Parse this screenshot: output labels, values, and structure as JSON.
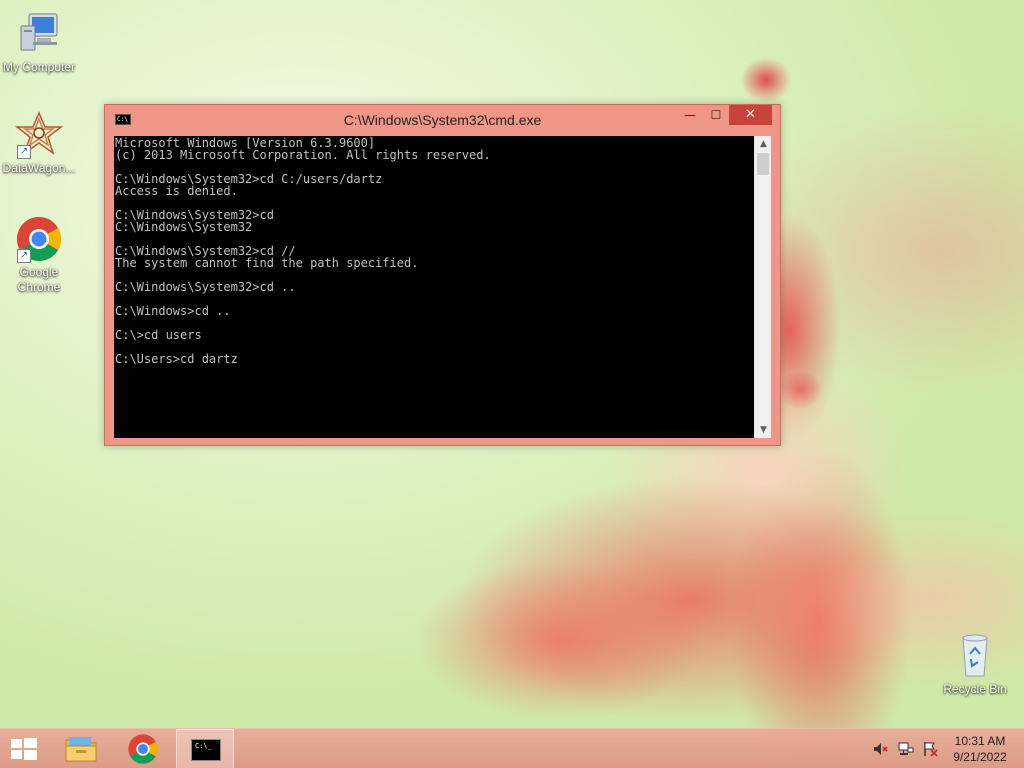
{
  "desktop": {
    "icons": [
      {
        "label": "My Computer",
        "icon": "computer-icon"
      },
      {
        "label": "DataWagon...",
        "icon": "datawagon-icon"
      },
      {
        "label_line1": "Google",
        "label_line2": "Chrome",
        "icon": "chrome-icon"
      },
      {
        "label": "Recycle Bin",
        "icon": "recycle-bin-icon"
      }
    ]
  },
  "window": {
    "title": "C:\\Windows\\System32\\cmd.exe",
    "icon_text": "C:\\",
    "buttons": {
      "minimize": "—",
      "maximize": "☐",
      "close": "✕"
    },
    "console_lines": [
      "Microsoft Windows [Version 6.3.9600]",
      "(c) 2013 Microsoft Corporation. All rights reserved.",
      "",
      "C:\\Windows\\System32>cd C:/users/dartz",
      "Access is denied.",
      "",
      "C:\\Windows\\System32>cd",
      "C:\\Windows\\System32",
      "",
      "C:\\Windows\\System32>cd //",
      "The system cannot find the path specified.",
      "",
      "C:\\Windows\\System32>cd ..",
      "",
      "C:\\Windows>cd ..",
      "",
      "C:\\>cd users",
      "",
      "C:\\Users>cd dartz"
    ],
    "scroll": {
      "up": "▲",
      "down": "▼"
    }
  },
  "taskbar": {
    "items": [
      "start-button",
      "file-explorer",
      "google-chrome",
      "command-prompt"
    ],
    "cmd_icon_text": "C:\\_",
    "tray_icons": [
      "speaker-muted-icon",
      "network-icon",
      "action-center-flag-icon"
    ],
    "clock": {
      "time": "10:31 AM",
      "date": "9/21/2022"
    }
  },
  "colors": {
    "window_frame": "#f09686",
    "close_button": "#c7443a",
    "console_bg": "#000000",
    "console_text": "#c0c0c0"
  }
}
